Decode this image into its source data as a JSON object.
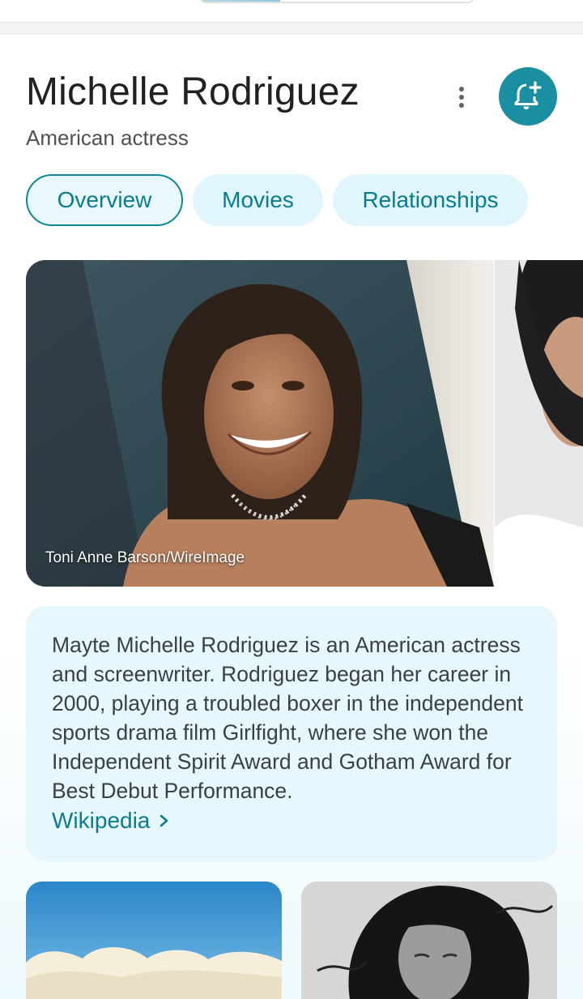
{
  "header": {
    "title": "Michelle Rodriguez",
    "subtitle": "American actress"
  },
  "tabs": [
    {
      "label": "Overview",
      "active": true
    },
    {
      "label": "Movies",
      "active": false
    },
    {
      "label": "Relationships",
      "active": false
    }
  ],
  "gallery": {
    "main_image_credit": "Toni Anne Barson/WireImage"
  },
  "description": {
    "text": "Mayte Michelle Rodriguez is an American actress and screenwriter. Rodriguez began her career in 2000, playing a troubled boxer in the independent sports drama film Girlfight, where she won the Independent Spirit Award and Gotham Award for Best Debut Performance.",
    "source_link": "Wikipedia"
  },
  "icons": {
    "more": "more-vert-icon",
    "follow": "bell-add-icon",
    "chevron": "chevron-right-icon"
  },
  "colors": {
    "accent": "#1a8fa2",
    "tab_bg": "#e0f6fc",
    "tab_text": "#0a7c8e",
    "desc_bg": "#e6f8fd"
  }
}
